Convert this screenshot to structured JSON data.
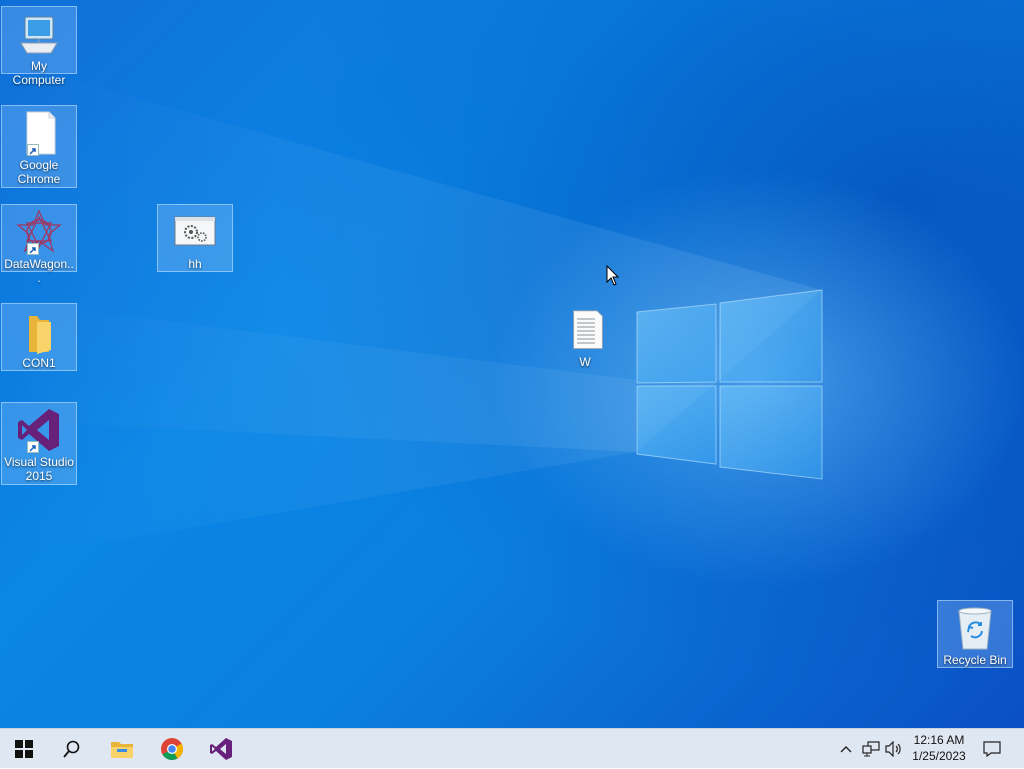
{
  "desktop": {
    "icons": [
      {
        "label": "My Computer",
        "icon": "computer-icon"
      },
      {
        "label": "Google Chrome",
        "icon": "blank-document-icon",
        "shortcut": true
      },
      {
        "label": "DataWagon...",
        "icon": "datawagon-star-icon",
        "shortcut": true
      },
      {
        "label": "hh",
        "icon": "settings-window-icon"
      },
      {
        "label": "CON1",
        "icon": "folder-icon"
      },
      {
        "label": "Visual Studio 2015",
        "icon": "visual-studio-icon",
        "shortcut": true
      },
      {
        "label": "W",
        "icon": "text-document-icon"
      },
      {
        "label": "Recycle Bin",
        "icon": "recycle-bin-icon"
      }
    ]
  },
  "taskbar": {
    "start_icon": "windows-start-icon",
    "search_icon": "search-icon",
    "pinned": [
      "file-explorer-icon",
      "chrome-icon",
      "visual-studio-icon"
    ],
    "tray": {
      "icons": [
        "chevron-up-icon",
        "network-icon",
        "volume-icon"
      ],
      "time": "12:16 AM",
      "date": "1/25/2023",
      "notification_icon": "action-center-icon"
    }
  },
  "colors": {
    "wallpaper": "#0a86e6",
    "taskbar": "#dfe8f2",
    "selection": "#aad2ff"
  }
}
